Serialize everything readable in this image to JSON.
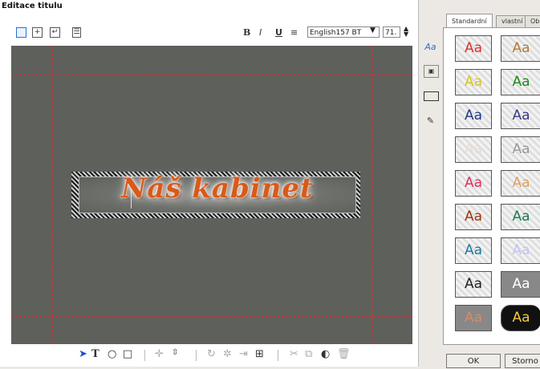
{
  "window": {
    "title": "Editace titulu"
  },
  "toolbar": {
    "font_name": "English157 BT",
    "font_size": "71.",
    "bold_label": "B",
    "italic_label": "I",
    "underline_label": "U",
    "align_label": "≡",
    "left_icons": [
      "frame-icon",
      "plus-box-icon",
      "arrow-box-icon",
      "layers-icon"
    ]
  },
  "canvas": {
    "background": "#5e605c",
    "guide_color": "#c43a3a",
    "title_text": "Náš kabinet",
    "text_color": "#d85a1a"
  },
  "bottom_toolbar": {
    "tools": [
      "pointer-icon",
      "text-icon",
      "ellipse-icon",
      "rectangle-icon",
      "move-icon",
      "align-icon",
      "rotate-icon",
      "sparkle-icon",
      "distribute-icon",
      "grid-icon",
      "cut-icon",
      "copy-icon",
      "paste-icon",
      "delete-icon"
    ]
  },
  "side_panel": {
    "icons": [
      "text-style-icon",
      "image-icon",
      "frame-style-icon",
      "brush-icon"
    ],
    "tabs": [
      "Standardní",
      "vlastní",
      "Obl"
    ],
    "styles": [
      {
        "label": "Aa",
        "color": "#e03030"
      },
      {
        "label": "Aa",
        "color": "#b57a3a"
      },
      {
        "label": "Aa",
        "color": "#d9c520"
      },
      {
        "label": "Aa",
        "color": "#1f8b1f"
      },
      {
        "label": "Aa",
        "color": "#1d3c8a"
      },
      {
        "label": "Aa",
        "color": "#3b3b8a"
      },
      {
        "label": "Aa",
        "color": "#e8ddd5"
      },
      {
        "label": "Aa",
        "color": "#9a9a9a"
      },
      {
        "label": "Aa",
        "color": "#e0305a"
      },
      {
        "label": "Aa",
        "color": "#e0a060"
      },
      {
        "label": "Aa",
        "color": "#a0360f"
      },
      {
        "label": "Aa",
        "color": "#1f7a50"
      },
      {
        "label": "Aa",
        "color": "#1d7aa0"
      },
      {
        "label": "Aa",
        "color": "#c0c0ff"
      },
      {
        "label": "Aa",
        "color": "#222222"
      },
      {
        "label": "Aa",
        "color": "#ffffff"
      },
      {
        "label": "Aa",
        "color": "#d98a6a"
      },
      {
        "label": "Aa",
        "color": "#f5c842"
      }
    ]
  },
  "buttons": {
    "ok": "OK",
    "cancel": "Storno"
  }
}
